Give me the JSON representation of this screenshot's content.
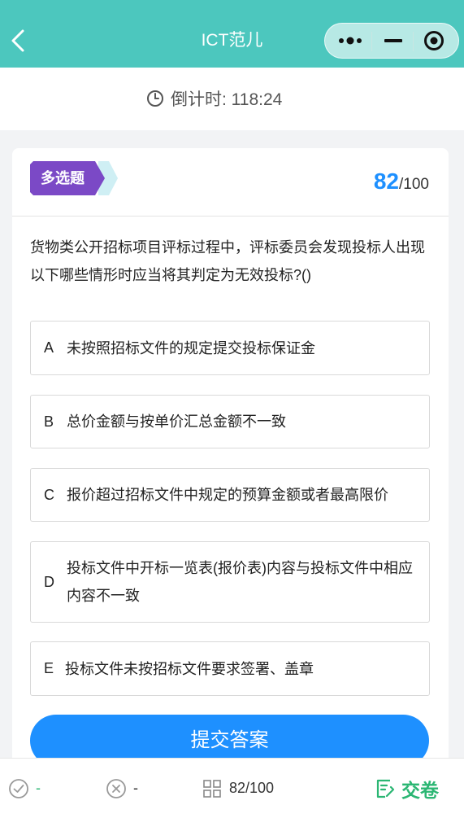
{
  "header": {
    "title": "ICT范儿",
    "back_icon": "chevron-left-icon",
    "more_icon": "more-dots-icon",
    "minimize_icon": "minus-icon",
    "close_icon": "target-circle-icon",
    "bg_color": "#4cc7be"
  },
  "timer": {
    "icon": "clock-icon",
    "label": "倒计时: 118:24"
  },
  "question": {
    "type_badge": "多选题",
    "badge_color": "#7b49c6",
    "current": "82",
    "total": "/100",
    "text": "货物类公开招标项目评标过程中，评标委员会发现投标人出现以下哪些情形时应当将其判定为无效投标?()",
    "options": [
      {
        "letter": "A",
        "text": "未按照招标文件的规定提交投标保证金"
      },
      {
        "letter": "B",
        "text": "总价金额与按单价汇总金额不一致"
      },
      {
        "letter": "C",
        "text": "报价超过招标文件中规定的预算金额或者最高限价"
      },
      {
        "letter": "D",
        "text": "投标文件中开标一览表(报价表)内容与投标文件中相应内容不一致"
      },
      {
        "letter": "E",
        "text": "投标文件未按招标文件要求签署、盖章"
      }
    ]
  },
  "submit_label": "提交答案",
  "bottom": {
    "correct_icon": "check-circle-icon",
    "correct_value": "-",
    "wrong_icon": "x-circle-icon",
    "wrong_value": "-",
    "grid_icon": "grid-icon",
    "progress": "82/100",
    "submit_icon": "paper-edit-icon",
    "submit_label": "交卷"
  }
}
